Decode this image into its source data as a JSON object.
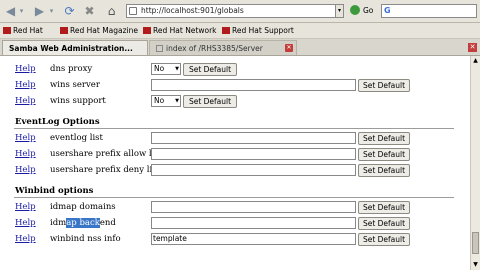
{
  "browser": {
    "url": "http://localhost:901/globals",
    "go_label": "Go",
    "search_glyph": "G"
  },
  "bookmarks": [
    {
      "label": "Red Hat"
    },
    {
      "label": "Red Hat Magazine"
    },
    {
      "label": "Red Hat Network"
    },
    {
      "label": "Red Hat Support"
    }
  ],
  "tabs": [
    {
      "label": "Samba Web Administration..."
    },
    {
      "label": "index of /RHS3385/Server"
    }
  ],
  "form": {
    "help_label": "Help",
    "set_default_label": "Set Default",
    "rows_top": [
      {
        "label": "dns proxy",
        "value": "No"
      },
      {
        "label": "wins server",
        "value": ""
      },
      {
        "label": "wins support",
        "value": "No"
      }
    ],
    "eventlog": {
      "title": "EventLog Options",
      "rows": [
        {
          "label": "eventlog list",
          "value": ""
        },
        {
          "label": "usershare prefix allow list",
          "value": ""
        },
        {
          "label": "usershare prefix deny list",
          "value": ""
        }
      ]
    },
    "winbind": {
      "title": "Winbind options",
      "rows": [
        {
          "label": "idmap domains",
          "value": ""
        },
        {
          "label_pre": "idm",
          "label_sel": "ap back",
          "label_post": "end",
          "value": ""
        },
        {
          "label": "winbind nss info",
          "value": "template"
        }
      ]
    }
  }
}
